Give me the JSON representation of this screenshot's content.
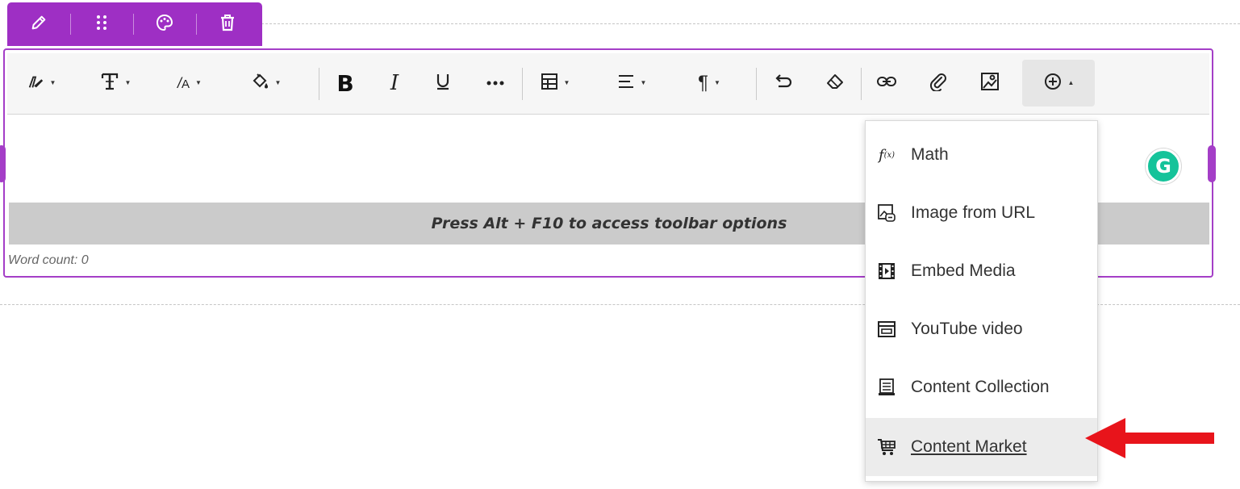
{
  "block_tools": {
    "items": [
      {
        "name": "edit",
        "icon": "pencil-icon"
      },
      {
        "name": "move",
        "icon": "drag-handle-icon"
      },
      {
        "name": "style",
        "icon": "palette-icon"
      },
      {
        "name": "delete",
        "icon": "trash-icon"
      }
    ]
  },
  "toolbar": {
    "buttons": [
      {
        "name": "format-painter",
        "icon": "format-painter-icon",
        "dropdown": true
      },
      {
        "name": "text-style",
        "icon": "text-style-icon",
        "dropdown": true
      },
      {
        "name": "font-size",
        "icon": "font-size-icon",
        "dropdown": true
      },
      {
        "name": "fill-color",
        "icon": "paint-bucket-icon",
        "dropdown": true
      },
      {
        "name": "bold",
        "icon": "bold-icon"
      },
      {
        "name": "italic",
        "icon": "italic-icon"
      },
      {
        "name": "underline",
        "icon": "underline-icon"
      },
      {
        "name": "more-formatting",
        "icon": "ellipsis-icon"
      },
      {
        "name": "table",
        "icon": "table-icon",
        "dropdown": true
      },
      {
        "name": "align",
        "icon": "align-left-icon",
        "dropdown": true
      },
      {
        "name": "paragraph",
        "icon": "pilcrow-icon",
        "dropdown": true
      },
      {
        "name": "undo",
        "icon": "undo-icon"
      },
      {
        "name": "clear-formatting",
        "icon": "eraser-icon"
      },
      {
        "name": "link",
        "icon": "link-icon"
      },
      {
        "name": "attach",
        "icon": "paperclip-icon"
      },
      {
        "name": "image",
        "icon": "image-icon"
      },
      {
        "name": "insert-content",
        "icon": "plus-circle-icon",
        "dropdown": true,
        "expanded": true
      }
    ]
  },
  "editor": {
    "hint": "Press Alt + F10 to access toolbar options",
    "word_count_label": "Word count: 0",
    "grammarly_letter": "G"
  },
  "insert_menu": {
    "items": [
      {
        "label": "Math",
        "icon": "math-function-icon"
      },
      {
        "label": "Image from URL",
        "icon": "image-url-icon"
      },
      {
        "label": "Embed Media",
        "icon": "film-icon"
      },
      {
        "label": "YouTube video",
        "icon": "video-player-icon"
      },
      {
        "label": "Content Collection",
        "icon": "content-collection-icon"
      },
      {
        "label": "Content Market",
        "icon": "cart-icon",
        "highlighted": true
      }
    ]
  },
  "colors": {
    "accent": "#a43ec7",
    "block_tools_bg": "#9e2fc4",
    "grammarly": "#15c39a",
    "annotation_arrow": "#e8141b"
  }
}
